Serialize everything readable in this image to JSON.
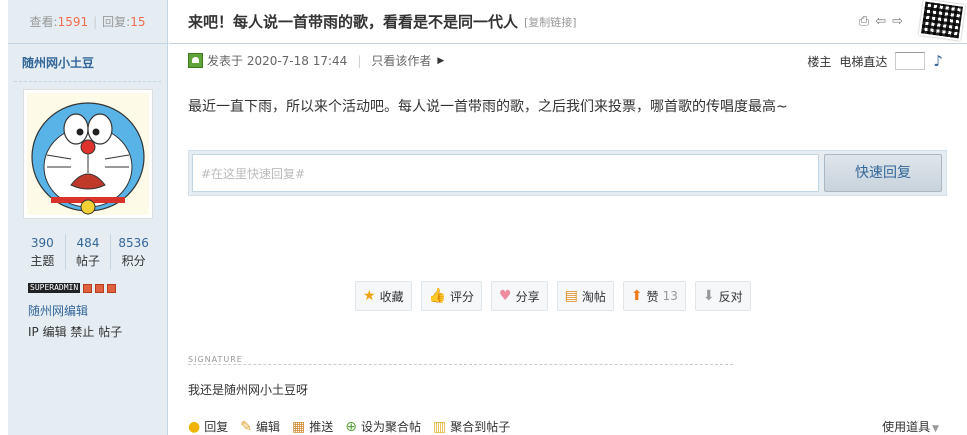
{
  "stats": {
    "views_label": "查看:",
    "views": "1591",
    "replies_label": "回复:",
    "replies": "15"
  },
  "author": {
    "name": "随州网小土豆",
    "topics": "390",
    "topics_label": "主题",
    "posts": "484",
    "posts_label": "帖子",
    "points": "8536",
    "points_label": "积分",
    "badge_text": "SUPERADMIN",
    "group": "随州网编辑",
    "ip_line": "IP 编辑 禁止 帖子"
  },
  "thread": {
    "title": "来吧！每人说一首带雨的歌，看看是不是同一代人",
    "copy_link": "[复制链接]",
    "icons": [
      "print-icon",
      "prev-thread-icon",
      "next-thread-icon"
    ]
  },
  "post": {
    "posted_at": "发表于 2020-7-18 17:44",
    "only_author": "只看该作者",
    "floor_label": "楼主",
    "elevator_label": "电梯直达",
    "message": "最近一直下雨，所以来个活动吧。每人说一首带雨的歌，之后我们来投票，哪首歌的传唱度最高~"
  },
  "quick_reply": {
    "placeholder": "#在这里快速回复#",
    "button": "快速回复"
  },
  "actions": [
    {
      "name": "favorite",
      "icon": "star-icon",
      "label": "收藏"
    },
    {
      "name": "rate",
      "icon": "thumb-icon",
      "label": "评分"
    },
    {
      "name": "share",
      "icon": "heart-icon",
      "label": "分享"
    },
    {
      "name": "tao",
      "icon": "folder-icon",
      "label": "淘帖"
    },
    {
      "name": "like",
      "icon": "up-arrow-icon",
      "label": "赞",
      "count": "13"
    },
    {
      "name": "oppose",
      "icon": "down-arrow-icon",
      "label": "反对"
    }
  ],
  "signature": {
    "label": "SIGNATURE",
    "text": "我还是随州网小土豆呀"
  },
  "bottom": {
    "reply": "回复",
    "edit": "编辑",
    "push": "推送",
    "set_aggregate": "设为聚合帖",
    "merge_to_post": "聚合到帖子",
    "tools": "使用道具"
  },
  "colors": {
    "link": "#336699",
    "accent": "#f26c4f",
    "sidebar_bg": "#e5edf2"
  }
}
